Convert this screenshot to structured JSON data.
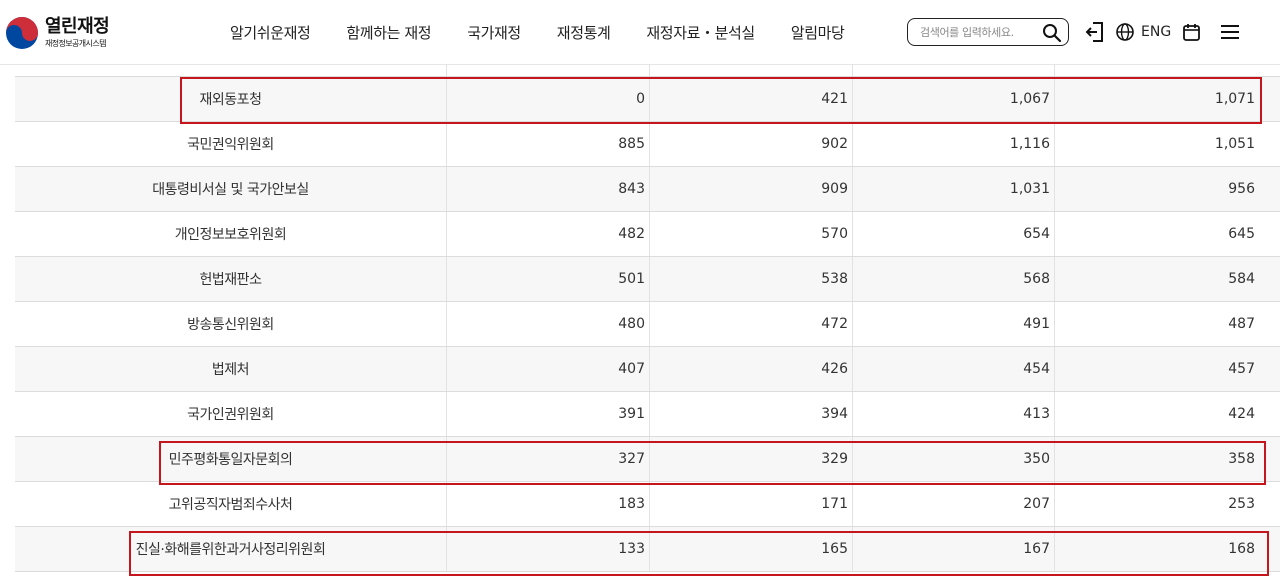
{
  "header": {
    "logo_title": "열린재정",
    "logo_subtitle": "재정정보공개시스템",
    "nav": [
      "알기쉬운재정",
      "함께하는 재정",
      "국가재정",
      "재정통계",
      "재정자료・분석실",
      "알림마당"
    ],
    "search_placeholder": "검색어를 입력하세요.",
    "eng_label": "ENG"
  },
  "table": {
    "rows": [
      {
        "name": "재외동포청",
        "v1": "0",
        "v2": "421",
        "v3": "1,067",
        "v4": "1,071",
        "highlighted": true
      },
      {
        "name": "국민권익위원회",
        "v1": "885",
        "v2": "902",
        "v3": "1,116",
        "v4": "1,051",
        "highlighted": false
      },
      {
        "name": "대통령비서실 및 국가안보실",
        "v1": "843",
        "v2": "909",
        "v3": "1,031",
        "v4": "956",
        "highlighted": false
      },
      {
        "name": "개인정보보호위원회",
        "v1": "482",
        "v2": "570",
        "v3": "654",
        "v4": "645",
        "highlighted": false
      },
      {
        "name": "헌법재판소",
        "v1": "501",
        "v2": "538",
        "v3": "568",
        "v4": "584",
        "highlighted": false
      },
      {
        "name": "방송통신위원회",
        "v1": "480",
        "v2": "472",
        "v3": "491",
        "v4": "487",
        "highlighted": false
      },
      {
        "name": "법제처",
        "v1": "407",
        "v2": "426",
        "v3": "454",
        "v4": "457",
        "highlighted": false
      },
      {
        "name": "국가인권위원회",
        "v1": "391",
        "v2": "394",
        "v3": "413",
        "v4": "424",
        "highlighted": false
      },
      {
        "name": "민주평화통일자문회의",
        "v1": "327",
        "v2": "329",
        "v3": "350",
        "v4": "358",
        "highlighted": true
      },
      {
        "name": "고위공직자범죄수사처",
        "v1": "183",
        "v2": "171",
        "v3": "207",
        "v4": "253",
        "highlighted": false
      },
      {
        "name": "진실·화해를위한과거사정리위원회",
        "v1": "133",
        "v2": "165",
        "v3": "167",
        "v4": "168",
        "highlighted": true
      }
    ]
  },
  "colors": {
    "highlight": "#c4161c",
    "row_alt": "#f7f7f7",
    "logo_red": "#cd2e3a",
    "logo_blue": "#0047a0"
  }
}
